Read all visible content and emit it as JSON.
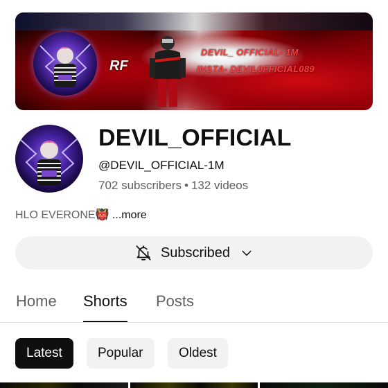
{
  "banner": {
    "label": "RF",
    "line1": "DEVIL_ OFFICIAL- 1M",
    "line2": "INSTA- DEVIL0FFICIAL089"
  },
  "channel": {
    "name": "DEVIL_OFFICIAL",
    "handle": "@DEVIL_OFFICIAL-1M",
    "subscribers": "702 subscribers",
    "separator": "•",
    "videos": "132 videos",
    "description": "HLO EVERONE👹",
    "more_label": "...more"
  },
  "subscribe_button": {
    "label": "Subscribed",
    "bell_icon": "bell-off-icon",
    "chevron_icon": "chevron-down-icon"
  },
  "tabs": [
    {
      "label": "Home",
      "active": false
    },
    {
      "label": "Shorts",
      "active": true
    },
    {
      "label": "Posts",
      "active": false
    }
  ],
  "filters": [
    {
      "label": "Latest",
      "active": true
    },
    {
      "label": "Popular",
      "active": false
    },
    {
      "label": "Oldest",
      "active": false
    }
  ],
  "colors": {
    "text_primary": "#0f0f0f",
    "text_secondary": "#606060",
    "chip_bg": "#f2f2f2",
    "chip_active_bg": "#0f0f0f",
    "banner_accent": "#ff3b3b"
  }
}
